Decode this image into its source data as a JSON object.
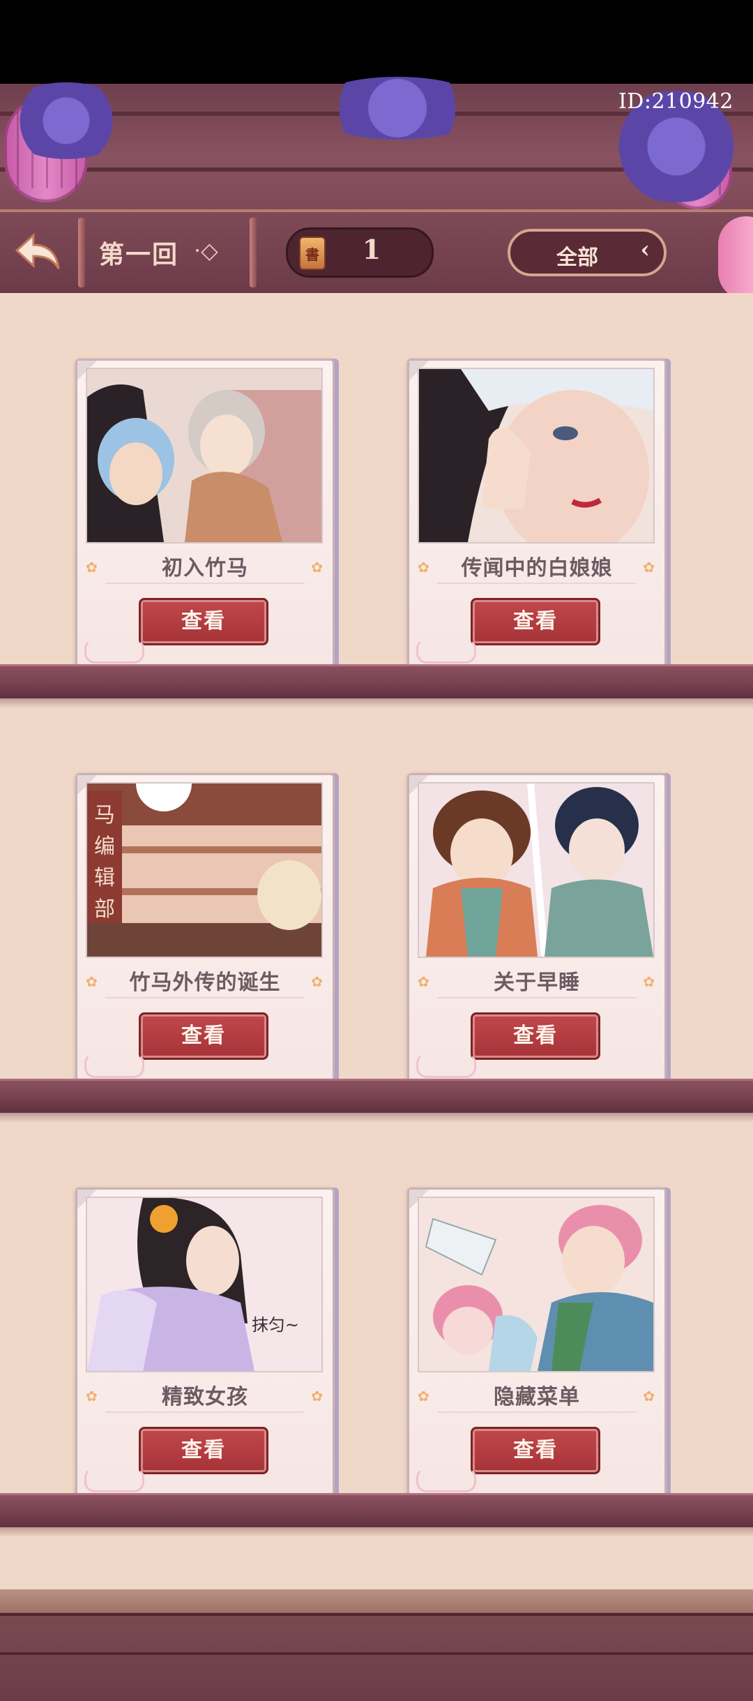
{
  "header": {
    "id_label": "ID:210942",
    "chapter_label": "第一回",
    "chapter_deco": "·◇",
    "counter_icon_text": "書",
    "counter_value": "1",
    "filter_label": "全部",
    "filter_arrow": "‹"
  },
  "cards": [
    {
      "title": "初入竹马",
      "button": "查看",
      "palette": [
        "#f0e6e2",
        "#d9b9a6",
        "#8fb3d9"
      ]
    },
    {
      "title": "传闻中的白娘娘",
      "button": "查看",
      "palette": [
        "#f3e2dc",
        "#2a2226",
        "#e7c2b4"
      ]
    },
    {
      "title": "竹马外传的诞生",
      "button": "查看",
      "palette": [
        "#e7c7b6",
        "#9b5a4a",
        "#f5e4d2"
      ]
    },
    {
      "title": "关于早睡",
      "button": "查看",
      "palette": [
        "#f3e3e6",
        "#d87d56",
        "#6fa49a"
      ]
    },
    {
      "title": "精致女孩",
      "button": "查看",
      "palette": [
        "#f5e6ea",
        "#2c2426",
        "#c9b4e6"
      ]
    },
    {
      "title": "隐藏菜单",
      "button": "查看",
      "palette": [
        "#f4e3df",
        "#ea8fab",
        "#7fa9c4"
      ]
    }
  ],
  "card_image_text": {
    "card3_sign": "马编辑部",
    "card5_speech": "抹匀~"
  },
  "colors": {
    "view_button": "#b03a3f",
    "card_title": "#6d5a62",
    "shelf": "#7a4252",
    "background": "#f0d8c8"
  },
  "icons": {
    "back": "back-arrow-icon",
    "counter": "scroll-icon",
    "filter": "chevron-left-icon"
  }
}
